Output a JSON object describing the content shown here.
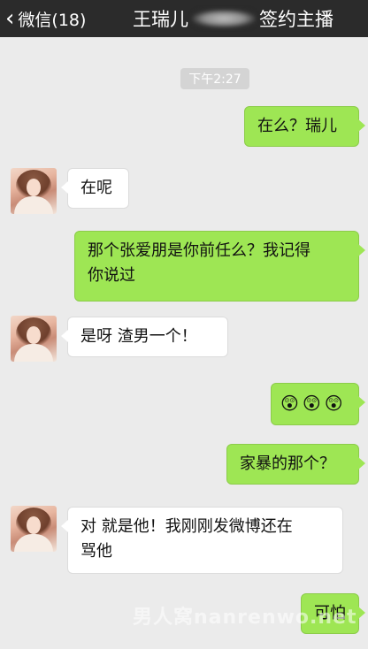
{
  "header": {
    "back_label": "微信(18)",
    "title_left": "王瑞儿",
    "title_right": "签约主播"
  },
  "chat": {
    "timestamp": "下午2:27",
    "messages": [
      {
        "side": "right",
        "text": "在么？瑞儿"
      },
      {
        "side": "left",
        "text": "在呢"
      },
      {
        "side": "right",
        "line1": "那个张爱朋是你前任么？我记得",
        "line2": "你说过"
      },
      {
        "side": "left",
        "text": "是呀 渣男一个！"
      },
      {
        "side": "right",
        "emojis": [
          "😲",
          "😲",
          "😲"
        ]
      },
      {
        "side": "right",
        "text": "家暴的那个？"
      },
      {
        "side": "left",
        "line1": "对 就是他！我刚刚发微博还在",
        "line2": "骂他"
      },
      {
        "side": "right",
        "text": "可怕"
      }
    ]
  },
  "watermark": "男人窝nanrenwo.net",
  "colors": {
    "topbar": "#2b2b2b",
    "background": "#ebebeb",
    "bubble_sent": "#9ee654",
    "bubble_received": "#ffffff"
  }
}
